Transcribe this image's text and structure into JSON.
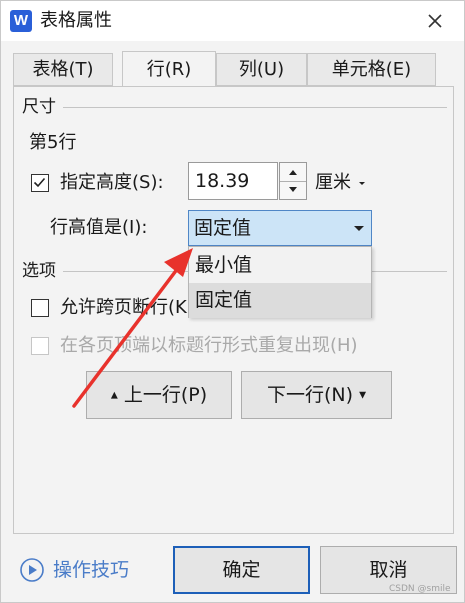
{
  "window": {
    "title": "表格属性",
    "logo": "W"
  },
  "tabs": [
    {
      "label": "表格(T)"
    },
    {
      "label": "行(R)"
    },
    {
      "label": "列(U)"
    },
    {
      "label": "单元格(E)"
    }
  ],
  "size_section": {
    "heading": "尺寸",
    "row_label": "第5行",
    "specify_height": {
      "label": "指定高度(S):",
      "checked": true
    },
    "height_value": "18.39",
    "unit": "厘米",
    "row_height_is": {
      "label": "行高值是(I):",
      "selected": "固定值"
    },
    "dropdown_options": [
      "最小值",
      "固定值"
    ]
  },
  "options_section": {
    "heading": "选项",
    "allow_break": {
      "label": "允许跨页断行(K)",
      "checked": false
    },
    "repeat_header": {
      "label": "在各页顶端以标题行形式重复出现(H)",
      "checked": false,
      "disabled": true
    }
  },
  "nav_buttons": {
    "prev": "上一行(P)",
    "next": "下一行(N)"
  },
  "footer": {
    "tips": "操作技巧",
    "ok": "确定",
    "cancel": "取消"
  },
  "watermark": "CSDN @smile",
  "colors": {
    "accent": "#1d5fb8",
    "select_bg": "#cce4f7",
    "arrow": "#e8322c",
    "logo": "#2a5fd8"
  }
}
